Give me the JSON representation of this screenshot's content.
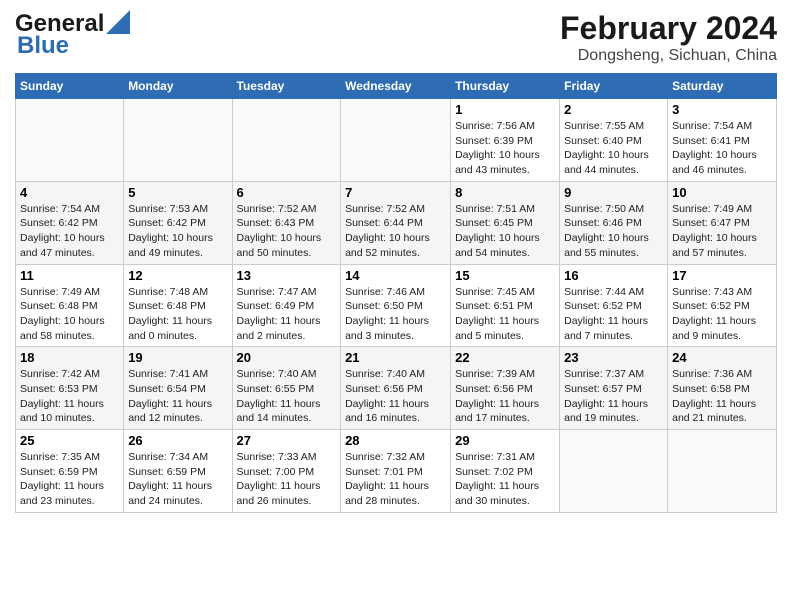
{
  "header": {
    "logo_line1": "General",
    "logo_line2": "Blue",
    "month_year": "February 2024",
    "location": "Dongsheng, Sichuan, China"
  },
  "weekdays": [
    "Sunday",
    "Monday",
    "Tuesday",
    "Wednesday",
    "Thursday",
    "Friday",
    "Saturday"
  ],
  "weeks": [
    [
      {
        "day": "",
        "info": ""
      },
      {
        "day": "",
        "info": ""
      },
      {
        "day": "",
        "info": ""
      },
      {
        "day": "",
        "info": ""
      },
      {
        "day": "1",
        "info": "Sunrise: 7:56 AM\nSunset: 6:39 PM\nDaylight: 10 hours and 43 minutes."
      },
      {
        "day": "2",
        "info": "Sunrise: 7:55 AM\nSunset: 6:40 PM\nDaylight: 10 hours and 44 minutes."
      },
      {
        "day": "3",
        "info": "Sunrise: 7:54 AM\nSunset: 6:41 PM\nDaylight: 10 hours and 46 minutes."
      }
    ],
    [
      {
        "day": "4",
        "info": "Sunrise: 7:54 AM\nSunset: 6:42 PM\nDaylight: 10 hours and 47 minutes."
      },
      {
        "day": "5",
        "info": "Sunrise: 7:53 AM\nSunset: 6:42 PM\nDaylight: 10 hours and 49 minutes."
      },
      {
        "day": "6",
        "info": "Sunrise: 7:52 AM\nSunset: 6:43 PM\nDaylight: 10 hours and 50 minutes."
      },
      {
        "day": "7",
        "info": "Sunrise: 7:52 AM\nSunset: 6:44 PM\nDaylight: 10 hours and 52 minutes."
      },
      {
        "day": "8",
        "info": "Sunrise: 7:51 AM\nSunset: 6:45 PM\nDaylight: 10 hours and 54 minutes."
      },
      {
        "day": "9",
        "info": "Sunrise: 7:50 AM\nSunset: 6:46 PM\nDaylight: 10 hours and 55 minutes."
      },
      {
        "day": "10",
        "info": "Sunrise: 7:49 AM\nSunset: 6:47 PM\nDaylight: 10 hours and 57 minutes."
      }
    ],
    [
      {
        "day": "11",
        "info": "Sunrise: 7:49 AM\nSunset: 6:48 PM\nDaylight: 10 hours and 58 minutes."
      },
      {
        "day": "12",
        "info": "Sunrise: 7:48 AM\nSunset: 6:48 PM\nDaylight: 11 hours and 0 minutes."
      },
      {
        "day": "13",
        "info": "Sunrise: 7:47 AM\nSunset: 6:49 PM\nDaylight: 11 hours and 2 minutes."
      },
      {
        "day": "14",
        "info": "Sunrise: 7:46 AM\nSunset: 6:50 PM\nDaylight: 11 hours and 3 minutes."
      },
      {
        "day": "15",
        "info": "Sunrise: 7:45 AM\nSunset: 6:51 PM\nDaylight: 11 hours and 5 minutes."
      },
      {
        "day": "16",
        "info": "Sunrise: 7:44 AM\nSunset: 6:52 PM\nDaylight: 11 hours and 7 minutes."
      },
      {
        "day": "17",
        "info": "Sunrise: 7:43 AM\nSunset: 6:52 PM\nDaylight: 11 hours and 9 minutes."
      }
    ],
    [
      {
        "day": "18",
        "info": "Sunrise: 7:42 AM\nSunset: 6:53 PM\nDaylight: 11 hours and 10 minutes."
      },
      {
        "day": "19",
        "info": "Sunrise: 7:41 AM\nSunset: 6:54 PM\nDaylight: 11 hours and 12 minutes."
      },
      {
        "day": "20",
        "info": "Sunrise: 7:40 AM\nSunset: 6:55 PM\nDaylight: 11 hours and 14 minutes."
      },
      {
        "day": "21",
        "info": "Sunrise: 7:40 AM\nSunset: 6:56 PM\nDaylight: 11 hours and 16 minutes."
      },
      {
        "day": "22",
        "info": "Sunrise: 7:39 AM\nSunset: 6:56 PM\nDaylight: 11 hours and 17 minutes."
      },
      {
        "day": "23",
        "info": "Sunrise: 7:37 AM\nSunset: 6:57 PM\nDaylight: 11 hours and 19 minutes."
      },
      {
        "day": "24",
        "info": "Sunrise: 7:36 AM\nSunset: 6:58 PM\nDaylight: 11 hours and 21 minutes."
      }
    ],
    [
      {
        "day": "25",
        "info": "Sunrise: 7:35 AM\nSunset: 6:59 PM\nDaylight: 11 hours and 23 minutes."
      },
      {
        "day": "26",
        "info": "Sunrise: 7:34 AM\nSunset: 6:59 PM\nDaylight: 11 hours and 24 minutes."
      },
      {
        "day": "27",
        "info": "Sunrise: 7:33 AM\nSunset: 7:00 PM\nDaylight: 11 hours and 26 minutes."
      },
      {
        "day": "28",
        "info": "Sunrise: 7:32 AM\nSunset: 7:01 PM\nDaylight: 11 hours and 28 minutes."
      },
      {
        "day": "29",
        "info": "Sunrise: 7:31 AM\nSunset: 7:02 PM\nDaylight: 11 hours and 30 minutes."
      },
      {
        "day": "",
        "info": ""
      },
      {
        "day": "",
        "info": ""
      }
    ]
  ]
}
